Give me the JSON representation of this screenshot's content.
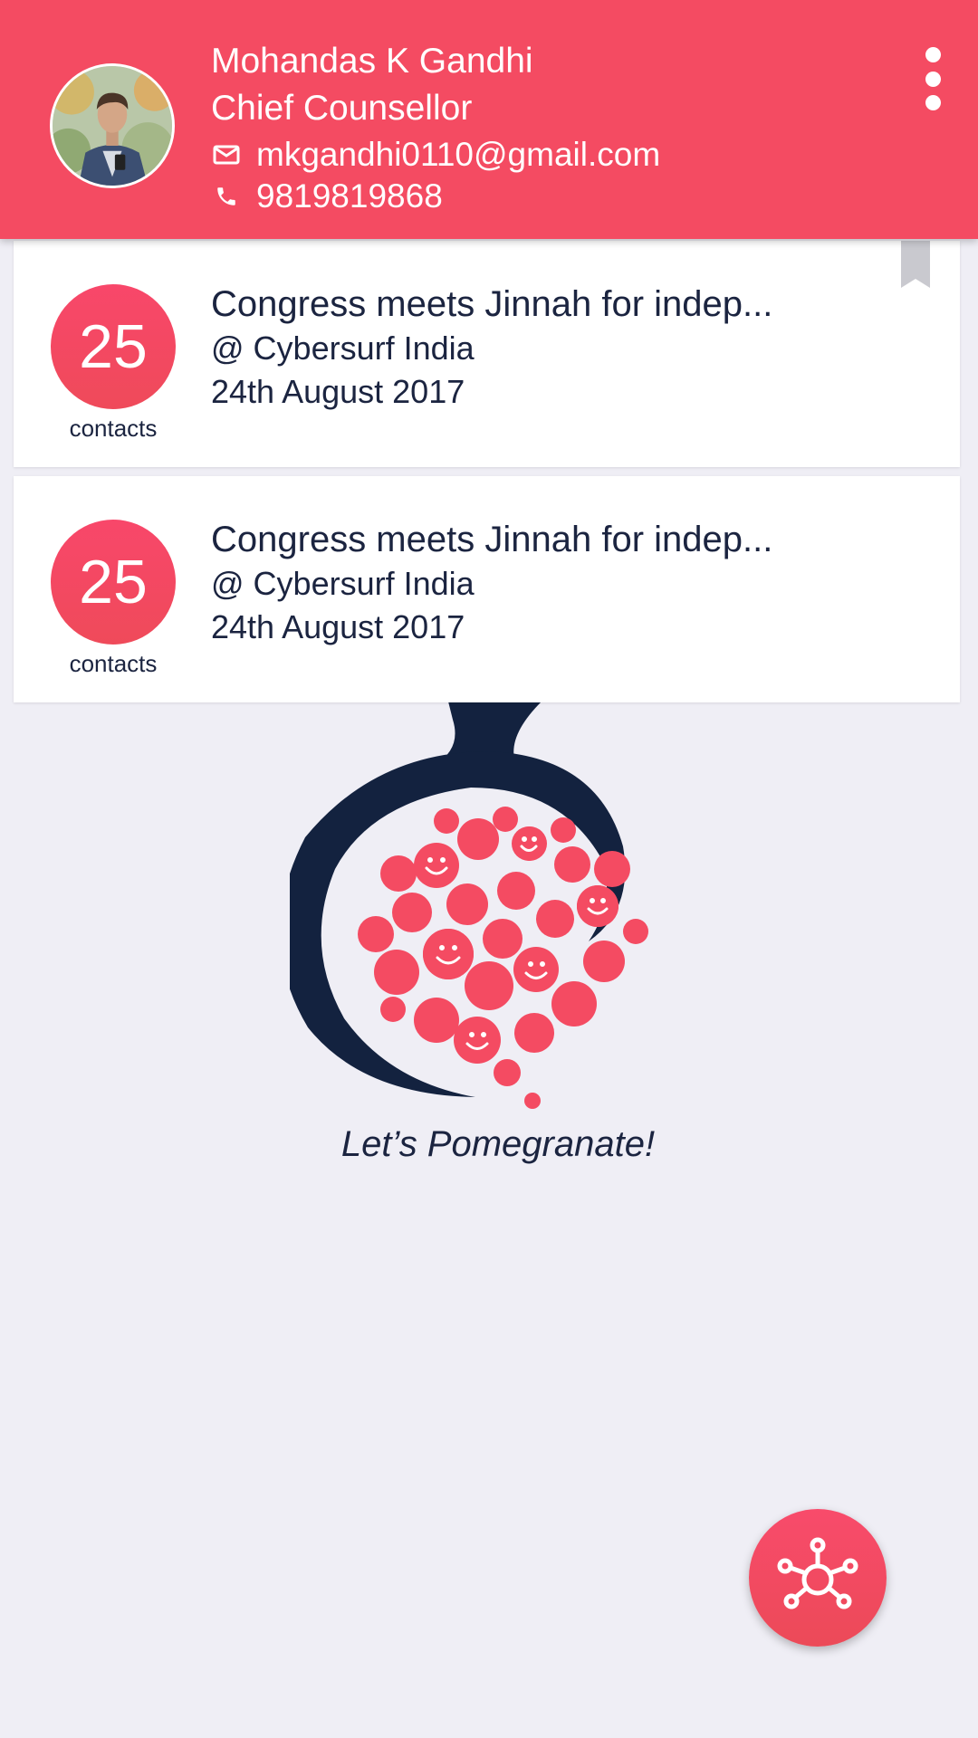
{
  "header": {
    "name": "Mohandas K Gandhi",
    "title": "Chief Counsellor",
    "email": "mkgandhi0110@gmail.com",
    "phone": "9819819868",
    "avatar_icon": "profile-photo",
    "menu_icon": "more-vert-icon",
    "bg_color": "#f44b62"
  },
  "events": [
    {
      "count": "25",
      "count_label": "contacts",
      "title": "Congress meets Jinnah for indep...",
      "venue": "@ Cybersurf India",
      "date": "24th August 2017",
      "bookmarked": true
    },
    {
      "count": "25",
      "count_label": "contacts",
      "title": "Congress meets Jinnah for indep...",
      "venue": "@ Cybersurf India",
      "date": "24th August 2017",
      "bookmarked": false
    }
  ],
  "brand": {
    "tagline": "Let’s Pomegranate!",
    "logo_icon": "pomegranate-logo",
    "navy": "#13223f",
    "accent": "#f44b62"
  },
  "fab": {
    "icon": "network-hub-icon"
  }
}
